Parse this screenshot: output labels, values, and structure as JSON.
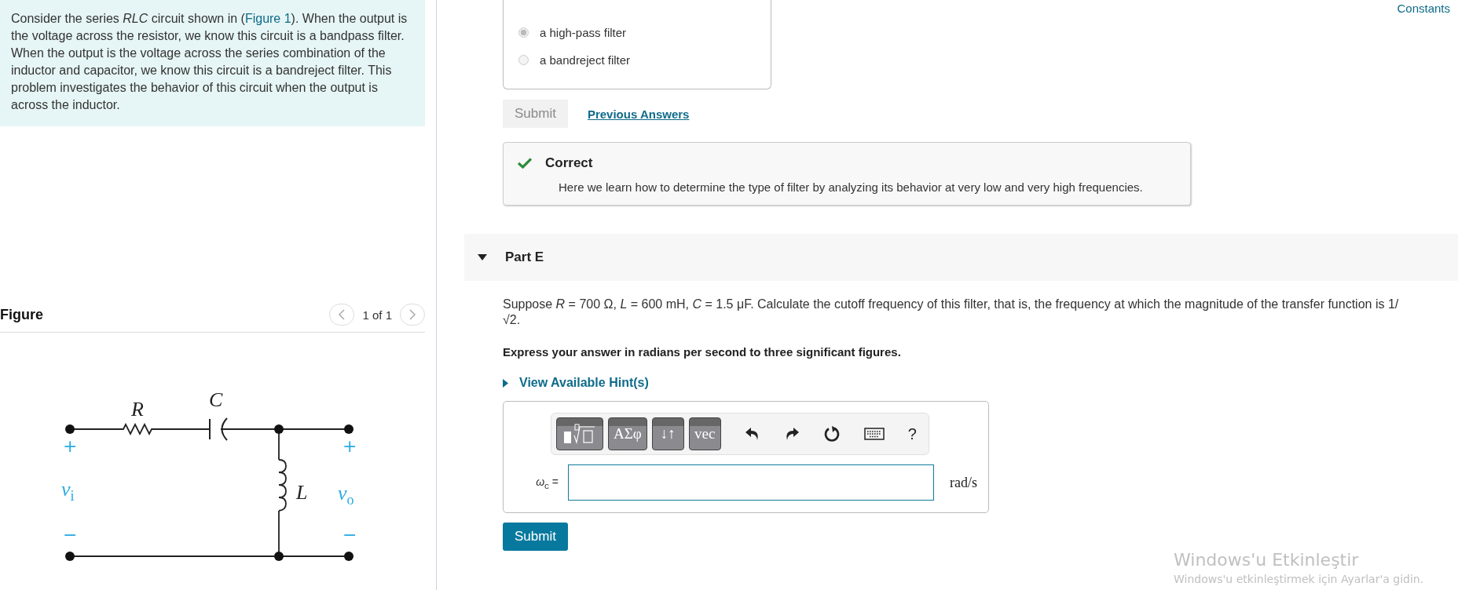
{
  "intro": {
    "parts": [
      {
        "kind": "text",
        "text": "Consider the series *RLC* circuit shown in ("
      },
      {
        "kind": "link",
        "text": "Figure 1"
      },
      {
        "kind": "text",
        "text": "). When the output is the voltage across the resistor, we know this circuit is a bandpass filter. When the output is the voltage across the series combination of the inductor and capacitor, we know this circuit is a bandreject filter. This problem investigates the behavior of this circuit when the output is across the inductor."
      }
    ]
  },
  "figure": {
    "title": "Figure",
    "pager": "1 of 1",
    "labels": {
      "r": "R",
      "c": "C",
      "l": "L",
      "vi": "*v*$_{i}$",
      "vo": "*v*$_{o}$",
      "plus_in": "+",
      "plus_out": "+",
      "minus_in": "−",
      "minus_out": "−"
    }
  },
  "constants_link": "Constants",
  "previous_part": {
    "options": [
      {
        "label": "a high-pass filter",
        "selected": true
      },
      {
        "label": "a bandreject filter",
        "selected": false
      }
    ],
    "submit": {
      "label": "Submit",
      "disabled": true
    },
    "previous_answers": "Previous Answers",
    "feedback": {
      "correct": true,
      "title": "Correct",
      "message": "Here we learn how to determine the type of filter by analyzing its behavior at very low and very high frequencies."
    }
  },
  "part_e": {
    "title": "Part E",
    "expanded": true,
    "question": "Suppose *R* = 700 Ω, *L* = 600 mH, *C* = 1.5 μF. Calculate the cutoff frequency of this filter, that is, the frequency at which the magnitude of the transfer function is 1/√2.",
    "instruction": "Express your answer in radians per second to three significant figures.",
    "hint": "View Available Hint(s)",
    "toolbar": [
      {
        "kind": "templates"
      },
      {
        "kind": "text",
        "label": "ΑΣφ"
      },
      {
        "kind": "text",
        "label": "↓↑"
      },
      {
        "kind": "text",
        "label": "vec"
      },
      {
        "kind": "undo"
      },
      {
        "kind": "redo"
      },
      {
        "kind": "reset"
      },
      {
        "kind": "keyboard"
      },
      {
        "kind": "help",
        "label": "?"
      }
    ],
    "answer_label": "*ω*$_{c}$ =",
    "unit": "rad/s",
    "submit": {
      "label": "Submit",
      "disabled": false
    }
  },
  "os_overlay": {
    "title": "Windows'u Etkinleştir",
    "subtitle": "Windows'u etkinleştirmek için Ayarlar'a gidin."
  }
}
